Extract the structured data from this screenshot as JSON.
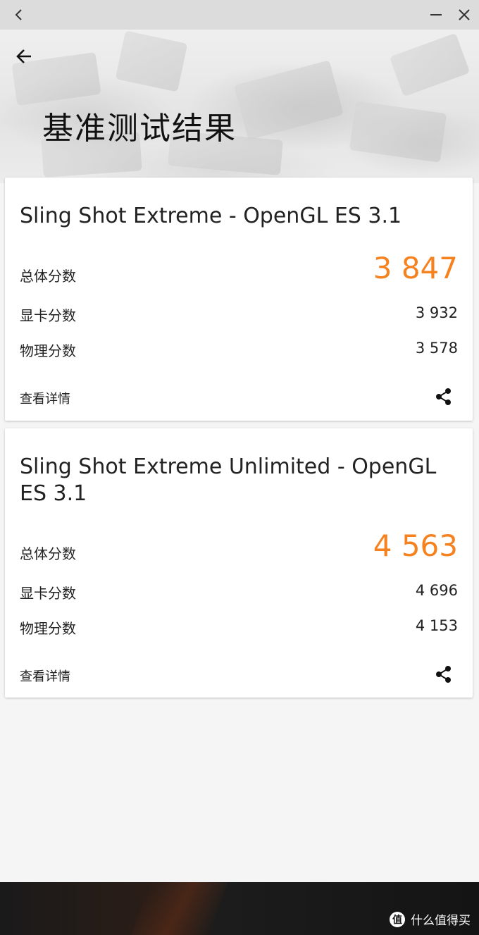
{
  "window": {
    "back_glyph": "‹",
    "minimize_icon": "minimize-icon",
    "close_icon": "close-icon"
  },
  "header": {
    "title": "基准测试结果",
    "back_icon": "arrow-left-icon"
  },
  "results": [
    {
      "name": "Sling Shot Extreme - OpenGL ES 3.1",
      "total_label": "总体分数",
      "total_value": "3 847",
      "graphics_label": "显卡分数",
      "graphics_value": "3 932",
      "physics_label": "物理分数",
      "physics_value": "3 578",
      "details_label": "查看详情",
      "share_icon": "share-icon"
    },
    {
      "name": "Sling Shot Extreme Unlimited - OpenGL ES 3.1",
      "total_label": "总体分数",
      "total_value": "4 563",
      "graphics_label": "显卡分数",
      "graphics_value": "4 696",
      "physics_label": "物理分数",
      "physics_value": "4 153",
      "details_label": "查看详情",
      "share_icon": "share-icon"
    }
  ],
  "watermark": {
    "badge": "值",
    "text": "什么值得买"
  },
  "colors": {
    "accent": "#f5821f",
    "window_bar": "#dcdcdc",
    "background": "#f5f5f5"
  }
}
